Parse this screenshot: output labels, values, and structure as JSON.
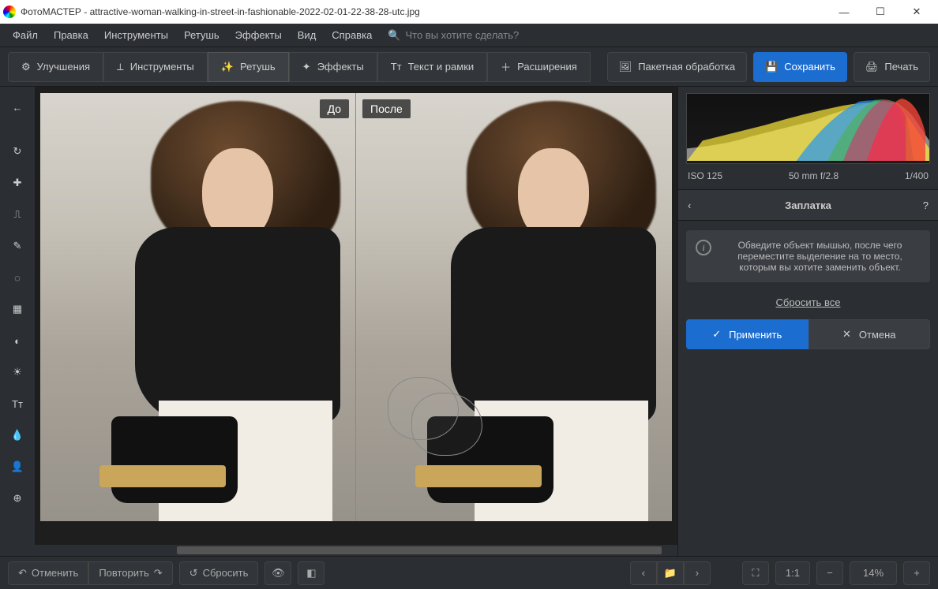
{
  "app_name": "ФотоМАСТЕР",
  "file_name": "attractive-woman-walking-in-street-in-fashionable-2022-02-01-22-38-28-utc.jpg",
  "menu": {
    "file": "Файл",
    "edit": "Правка",
    "tools": "Инструменты",
    "retouch": "Ретушь",
    "effects": "Эффекты",
    "view": "Вид",
    "help": "Справка",
    "search_placeholder": "Что вы хотите сделать?"
  },
  "tabs": {
    "improve": "Улучшения",
    "tools": "Инструменты",
    "retouch": "Ретушь",
    "effects": "Эффекты",
    "text": "Текст и рамки",
    "extensions": "Расширения"
  },
  "actions": {
    "batch": "Пакетная обработка",
    "save": "Сохранить",
    "print": "Печать"
  },
  "compare": {
    "before": "До",
    "after": "После"
  },
  "exif": {
    "iso": "ISO 125",
    "focal": "50 mm f/2.8",
    "shutter": "1/400"
  },
  "panel": {
    "title": "Заплатка",
    "hint": "Обведите объект мышью, после чего переместите выделение на то место, которым вы хотите заменить объект.",
    "reset": "Сбросить все",
    "apply": "Применить",
    "cancel": "Отмена"
  },
  "bottom": {
    "undo": "Отменить",
    "redo": "Повторить",
    "reset": "Сбросить",
    "ratio": "1:1",
    "zoom": "14%"
  }
}
